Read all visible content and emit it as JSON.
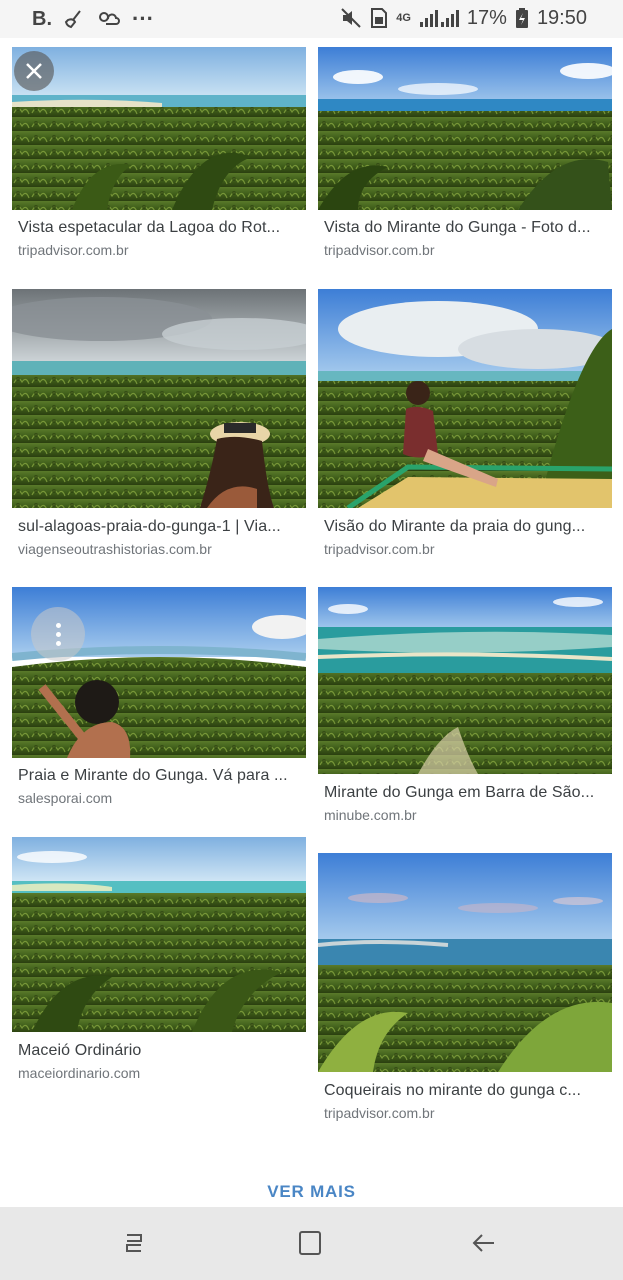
{
  "status_bar": {
    "left_icons": [
      "b-app-icon",
      "broom-icon",
      "weather-icon",
      "more-dots-icon"
    ],
    "b_label": "B.",
    "dots": "···",
    "right_icons": [
      "mute-icon",
      "sim-icon",
      "signal-icon",
      "battery-icon"
    ],
    "network": "4G",
    "battery": "17%",
    "time": "19:50"
  },
  "results": [
    {
      "title": "Vista espetacular da Lagoa do Rot...",
      "source": "tripadvisor.com.br"
    },
    {
      "title": "Vista do Mirante do Gunga - Foto d...",
      "source": "tripadvisor.com.br"
    },
    {
      "title": "sul-alagoas-praia-do-gunga-1 | Via...",
      "source": "viagenseoutrashistorias.com.br"
    },
    {
      "title": "Visão do Mirante da praia do gung...",
      "source": "tripadvisor.com.br"
    },
    {
      "title": "Praia e Mirante do Gunga. Vá para ...",
      "source": "salesporai.com"
    },
    {
      "title": "Mirante do Gunga em Barra de São...",
      "source": "minube.com.br"
    },
    {
      "title": "Maceió Ordinário",
      "source": "maceiordinario.com"
    },
    {
      "title": "Coqueirais no mirante do gunga c...",
      "source": "tripadvisor.com.br"
    }
  ],
  "ver_mais": "VER MAIS",
  "nav": {
    "recents": "recents-icon",
    "home": "home-icon",
    "back": "back-icon"
  }
}
